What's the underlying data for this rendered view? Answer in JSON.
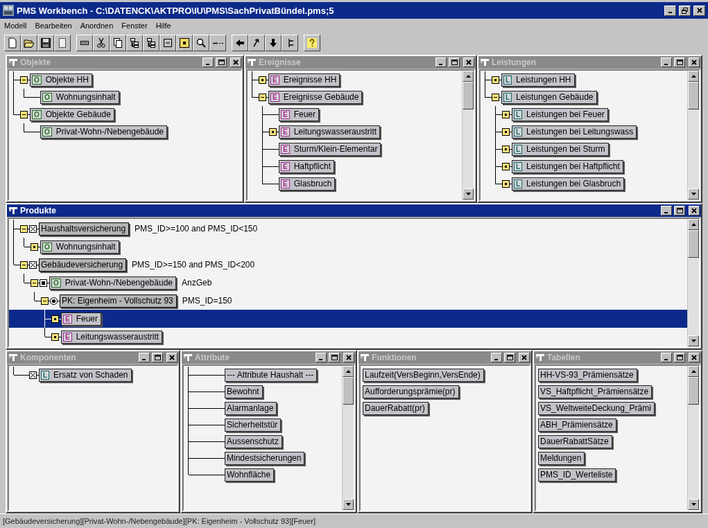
{
  "window": {
    "title": "PMS Workbench - C:\\DATENCK\\AKTPRO\\IU\\PMS\\SachPrivatBündel.pms;5"
  },
  "menu": [
    {
      "label": "Modell"
    },
    {
      "label": "Bearbeiten"
    },
    {
      "label": "Anordnen"
    },
    {
      "label": "Fenster"
    },
    {
      "label": "Hilfe"
    }
  ],
  "panels": [
    {
      "title": "Objekte",
      "active": false,
      "scrollbar": false,
      "kind": "tree",
      "items": [
        {
          "label": "Objekte HH",
          "badge": "O",
          "kind": "object",
          "expanded": true,
          "selected": false,
          "children": [
            {
              "label": "Wohnungsinhalt",
              "badge": "O",
              "kind": "object",
              "selected": false
            }
          ]
        },
        {
          "label": "Objekte Gebäude",
          "badge": "O",
          "kind": "object",
          "expanded": true,
          "selected": false,
          "children": [
            {
              "label": "Privat-Wohn-/Nebengebäude",
              "badge": "O",
              "kind": "object",
              "selected": false
            }
          ]
        }
      ]
    },
    {
      "title": "Ereignisse",
      "active": false,
      "scrollbar": true,
      "kind": "tree",
      "items": [
        {
          "label": "Ereignisse HH",
          "badge": "E",
          "kind": "event",
          "expanded": false,
          "selected": false
        },
        {
          "label": "Ereignisse Gebäude",
          "badge": "E",
          "kind": "event",
          "expanded": true,
          "selected": false,
          "children": [
            {
              "label": "Feuer",
              "badge": "E",
              "kind": "event",
              "selected": false
            },
            {
              "label": "Leitungswasseraustritt",
              "badge": "E",
              "kind": "event",
              "expanded": false,
              "selected": false
            },
            {
              "label": "Sturm/Klein-Elementar",
              "badge": "E",
              "kind": "event",
              "selected": false
            },
            {
              "label": "Haftpflicht",
              "badge": "E",
              "kind": "event",
              "selected": false
            },
            {
              "label": "Glasbruch",
              "badge": "E",
              "kind": "event",
              "selected": false
            }
          ]
        }
      ]
    },
    {
      "title": "Leistungen",
      "active": false,
      "scrollbar": true,
      "kind": "tree",
      "items": [
        {
          "label": "Leistungen HH",
          "badge": "L",
          "kind": "benefit",
          "expanded": false,
          "selected": false
        },
        {
          "label": "Leistungen Gebäude",
          "badge": "L",
          "kind": "benefit",
          "expanded": true,
          "selected": false,
          "children": [
            {
              "label": "Leistungen bei Feuer",
              "badge": "L",
              "kind": "benefit",
              "expanded": false,
              "selected": false
            },
            {
              "label": "Leistungen bei Leitungswass",
              "badge": "L",
              "kind": "benefit",
              "expanded": false,
              "selected": false
            },
            {
              "label": "Leistungen bei Sturm",
              "badge": "L",
              "kind": "benefit",
              "expanded": false,
              "selected": false
            },
            {
              "label": "Leistungen bei Haftpflicht",
              "badge": "L",
              "kind": "benefit",
              "expanded": false,
              "selected": false
            },
            {
              "label": "Leistungen bei Glasbruch",
              "badge": "L",
              "kind": "benefit",
              "expanded": false,
              "selected": false
            }
          ]
        }
      ]
    },
    {
      "title": "Produkte",
      "active": true,
      "scrollbar": true,
      "kind": "tree",
      "items": [
        {
          "label": "Haushaltsversicherung",
          "kind": "product",
          "marker": {
            "kind": "cross"
          },
          "condition": "PMS_ID>=100 and PMS_ID<150",
          "expanded": true,
          "selected": false,
          "children": [
            {
              "label": "Wohnungsinhalt",
              "badge": "O",
              "kind": "object",
              "expanded": false,
              "selected": false
            }
          ]
        },
        {
          "label": "Gebäudeversicherung",
          "kind": "product",
          "marker": {
            "kind": "cross"
          },
          "condition": "PMS_ID>=150 and PMS_ID<200",
          "expanded": true,
          "selected": false,
          "children": [
            {
              "label": "Privat-Wohn-/Nebengebäude",
              "badge": "O",
              "kind": "object",
              "marker": {
                "kind": "square"
              },
              "condition": "AnzGeb",
              "expanded": true,
              "selected": false,
              "children": [
                {
                  "label": "PK: Eigenheim - Vollschutz 93",
                  "kind": "product",
                  "marker": {
                    "kind": "radio"
                  },
                  "condition": "PMS_ID=150",
                  "expanded": true,
                  "selected": false,
                  "children": [
                    {
                      "label": "Feuer",
                      "badge": "E",
                      "kind": "event",
                      "expanded": false,
                      "selected": true
                    },
                    {
                      "label": "Leitungswasseraustritt",
                      "badge": "E",
                      "kind": "event",
                      "expanded": false,
                      "selected": false
                    }
                  ]
                }
              ]
            }
          ]
        }
      ]
    },
    {
      "title": "Komponenten",
      "active": false,
      "scrollbar": false,
      "kind": "tree",
      "items": [
        {
          "label": "Ersatz von Schaden",
          "badge": "L",
          "kind": "benefit",
          "marker": {
            "kind": "cross"
          },
          "selected": false
        }
      ]
    },
    {
      "title": "Attribute",
      "active": false,
      "scrollbar": true,
      "kind": "tree",
      "items": [
        {
          "label": "--- Attribute Haushalt ---",
          "kind": "plain",
          "selected": false
        },
        {
          "label": "Bewohnt",
          "kind": "plain",
          "selected": false
        },
        {
          "label": "Alarmanlage",
          "kind": "plain",
          "selected": false
        },
        {
          "label": "Sicherheitstür",
          "kind": "plain",
          "selected": false
        },
        {
          "label": "Aussenschutz",
          "kind": "plain",
          "selected": false
        },
        {
          "label": "Mindestsicherungen",
          "kind": "plain",
          "selected": false
        },
        {
          "label": "Wohnfläche",
          "kind": "plain",
          "selected": false
        }
      ]
    },
    {
      "title": "Funktionen",
      "active": false,
      "scrollbar": false,
      "kind": "list",
      "items": [
        {
          "label": "Laufzeit(VersBeginn,VersEnde)",
          "kind": "plain",
          "selected": false
        },
        {
          "label": "Aufforderungsprämie(pr)",
          "kind": "plain",
          "selected": false
        },
        {
          "label": "DauerRabatt(pr)",
          "kind": "plain",
          "selected": false
        }
      ]
    },
    {
      "title": "Tabellen",
      "active": false,
      "scrollbar": true,
      "kind": "list",
      "items": [
        {
          "label": "HH-VS-93_Prämiensätze",
          "kind": "plain",
          "selected": false
        },
        {
          "label": "VS_Haftpflicht_Prämiensätze",
          "kind": "plain",
          "selected": false
        },
        {
          "label": "VS_WeltweiteDeckung_Prämi",
          "kind": "plain",
          "selected": false
        },
        {
          "label": "ABH_Prämiensätze",
          "kind": "plain",
          "selected": false
        },
        {
          "label": "DauerRabattSätze",
          "kind": "plain",
          "selected": false
        },
        {
          "label": "Meldungen",
          "kind": "plain",
          "selected": false
        },
        {
          "label": "PMS_ID_Werteliste",
          "kind": "plain",
          "selected": false
        }
      ]
    }
  ],
  "status_bar": "[Gebäudeversicherung][Privat-Wohn-/Nebengebäude][PK: Eigenheim - Vollschutz 93][Feuer]"
}
